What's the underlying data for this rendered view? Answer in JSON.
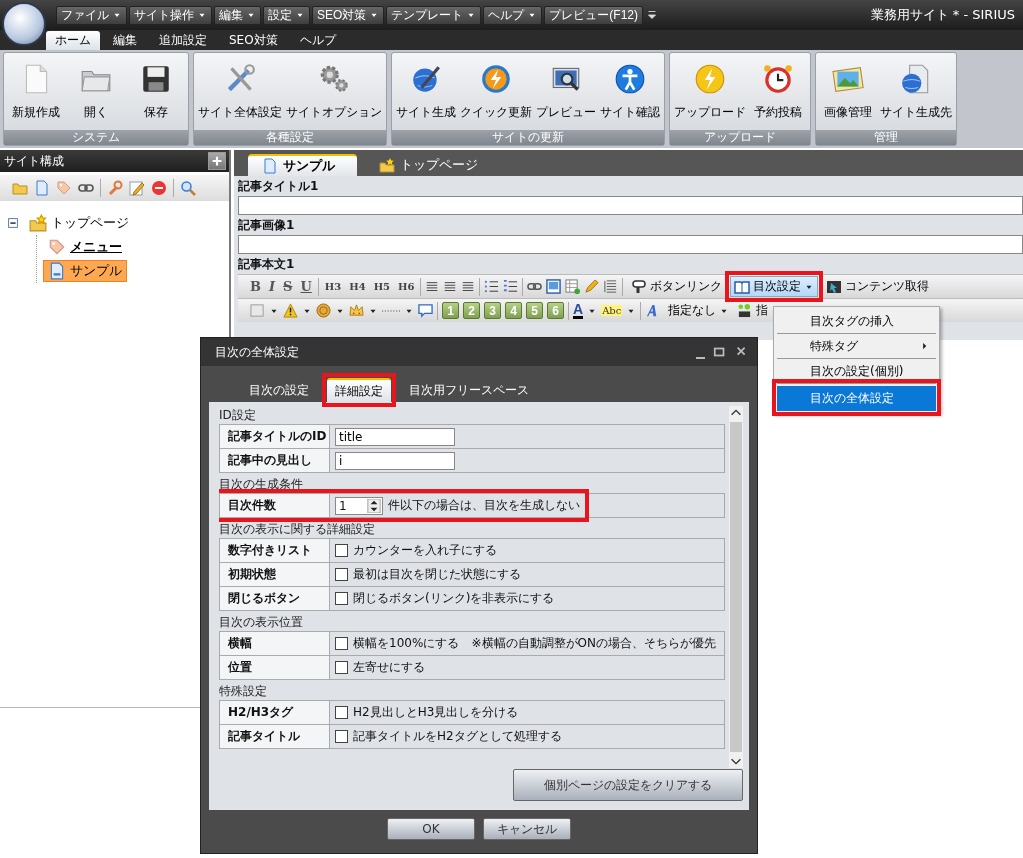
{
  "app": {
    "menu": [
      {
        "label": "ファイル",
        "dropdown": true
      },
      {
        "label": "サイト操作",
        "dropdown": true
      },
      {
        "label": "編集",
        "dropdown": true
      },
      {
        "label": "設定",
        "dropdown": true
      },
      {
        "label": "SEO対策",
        "dropdown": true
      },
      {
        "label": "テンプレート",
        "dropdown": true
      },
      {
        "label": "ヘルプ",
        "dropdown": true
      },
      {
        "label": "プレビュー(F12)",
        "dropdown": false
      }
    ],
    "title": "業務用サイト * - SIRIUS"
  },
  "ribbon_tabs": [
    {
      "label": "ホーム",
      "selected": true
    },
    {
      "label": "編集",
      "selected": false
    },
    {
      "label": "追加設定",
      "selected": false
    },
    {
      "label": "SEO対策",
      "selected": false
    },
    {
      "label": "ヘルプ",
      "selected": false
    }
  ],
  "ribbon_groups": [
    {
      "label": "システム",
      "buttons": [
        {
          "label": "新規作成"
        },
        {
          "label": "開く"
        },
        {
          "label": "保存"
        }
      ]
    },
    {
      "label": "各種設定",
      "buttons": [
        {
          "label": "サイト全体設定"
        },
        {
          "label": "サイトオプション"
        }
      ]
    },
    {
      "label": "サイトの更新",
      "buttons": [
        {
          "label": "サイト生成"
        },
        {
          "label": "クイック更新"
        },
        {
          "label": "プレビュー"
        },
        {
          "label": "サイト確認"
        }
      ]
    },
    {
      "label": "アップロード",
      "buttons": [
        {
          "label": "アップロード"
        },
        {
          "label": "予約投稿"
        }
      ]
    },
    {
      "label": "管理",
      "buttons": [
        {
          "label": "画像管理"
        },
        {
          "label": "サイト生成先"
        }
      ]
    }
  ],
  "sidebar": {
    "title": "サイト構成",
    "tree": [
      {
        "label": "トップページ",
        "kind": "home",
        "expanded": true,
        "selected": false,
        "children": [
          {
            "label": "メニュー",
            "kind": "menu",
            "selected": false
          },
          {
            "label": "サンプル",
            "kind": "page",
            "selected": true
          }
        ]
      }
    ]
  },
  "document_tabs": [
    {
      "label": "サンプル",
      "kind": "page",
      "selected": true
    },
    {
      "label": "トップページ",
      "kind": "home",
      "selected": false
    }
  ],
  "fields": [
    {
      "label": "記事タイトル1",
      "kind": "input"
    },
    {
      "label": "記事画像1",
      "kind": "input"
    },
    {
      "label": "記事本文1",
      "kind": "rich"
    }
  ],
  "toolbar": {
    "format": [
      "B",
      "I",
      "S",
      "U"
    ],
    "headings": [
      "H3",
      "H4",
      "H5",
      "H6"
    ],
    "buttons": [
      {
        "label": "ボタンリンク",
        "dropdown": false,
        "active": false,
        "highlighted": false
      },
      {
        "label": "目次設定",
        "dropdown": true,
        "active": true,
        "highlighted": true
      },
      {
        "label": "コンテンツ取得",
        "dropdown": false,
        "active": false,
        "highlighted": false
      }
    ],
    "numbers": [
      "1",
      "2",
      "3",
      "4",
      "5",
      "6"
    ],
    "colors": [
      "A",
      "Abc"
    ],
    "style": "指定なし",
    "style_cut": "指"
  },
  "dropdown_menu": [
    {
      "label": "目次タグの挿入",
      "selected": false,
      "submenu": false
    },
    {
      "label": "特殊タグ",
      "selected": false,
      "submenu": true
    },
    {
      "label": "目次の設定(個別)",
      "selected": false,
      "submenu": false
    },
    {
      "label": "目次の全体設定",
      "selected": true,
      "submenu": false,
      "highlighted": true
    }
  ],
  "dialog": {
    "title": "目次の全体設定",
    "tabs": [
      {
        "label": "目次の設定",
        "selected": false,
        "highlighted": false
      },
      {
        "label": "詳細設定",
        "selected": true,
        "highlighted": true
      },
      {
        "label": "目次用フリースペース",
        "selected": false,
        "highlighted": false
      }
    ],
    "sections": [
      {
        "title": "ID設定",
        "rows": [
          {
            "label": "記事タイトルのID",
            "kind": "text",
            "value": "title"
          },
          {
            "label": "記事中の見出し",
            "kind": "text",
            "value": "i"
          }
        ]
      },
      {
        "title": "目次の生成条件",
        "rows": [
          {
            "label": "目次件数",
            "kind": "spin",
            "value": "1",
            "text": "件以下の場合は、目次を生成しない",
            "highlighted": true
          }
        ]
      },
      {
        "title": "目次の表示に関する詳細設定",
        "rows": [
          {
            "label": "数字付きリスト",
            "kind": "checkbox",
            "checked": false,
            "text": "カウンターを入れ子にする"
          },
          {
            "label": "初期状態",
            "kind": "checkbox",
            "checked": false,
            "text": "最初は目次を閉じた状態にする"
          },
          {
            "label": "閉じるボタン",
            "kind": "checkbox",
            "checked": false,
            "text": "閉じるボタン(リンク)を非表示にする"
          }
        ]
      },
      {
        "title": "目次の表示位置",
        "rows": [
          {
            "label": "横幅",
            "kind": "checkbox",
            "checked": false,
            "text": "横幅を100%にする",
            "note": "※横幅の自動調整がONの場合、そちらが優先"
          },
          {
            "label": "位置",
            "kind": "checkbox",
            "checked": false,
            "text": "左寄せにする"
          }
        ]
      },
      {
        "title": "特殊設定",
        "rows": [
          {
            "label": "H2/H3タグ",
            "kind": "checkbox",
            "checked": false,
            "text": "H2見出しとH3見出しを分ける"
          },
          {
            "label": "記事タイトル",
            "kind": "checkbox",
            "checked": false,
            "text": "記事タイトルをH2タグとして処理する"
          }
        ]
      }
    ],
    "clear_button": "個別ページの設定をクリアする",
    "buttons": [
      "OK",
      "キャンセル"
    ]
  }
}
